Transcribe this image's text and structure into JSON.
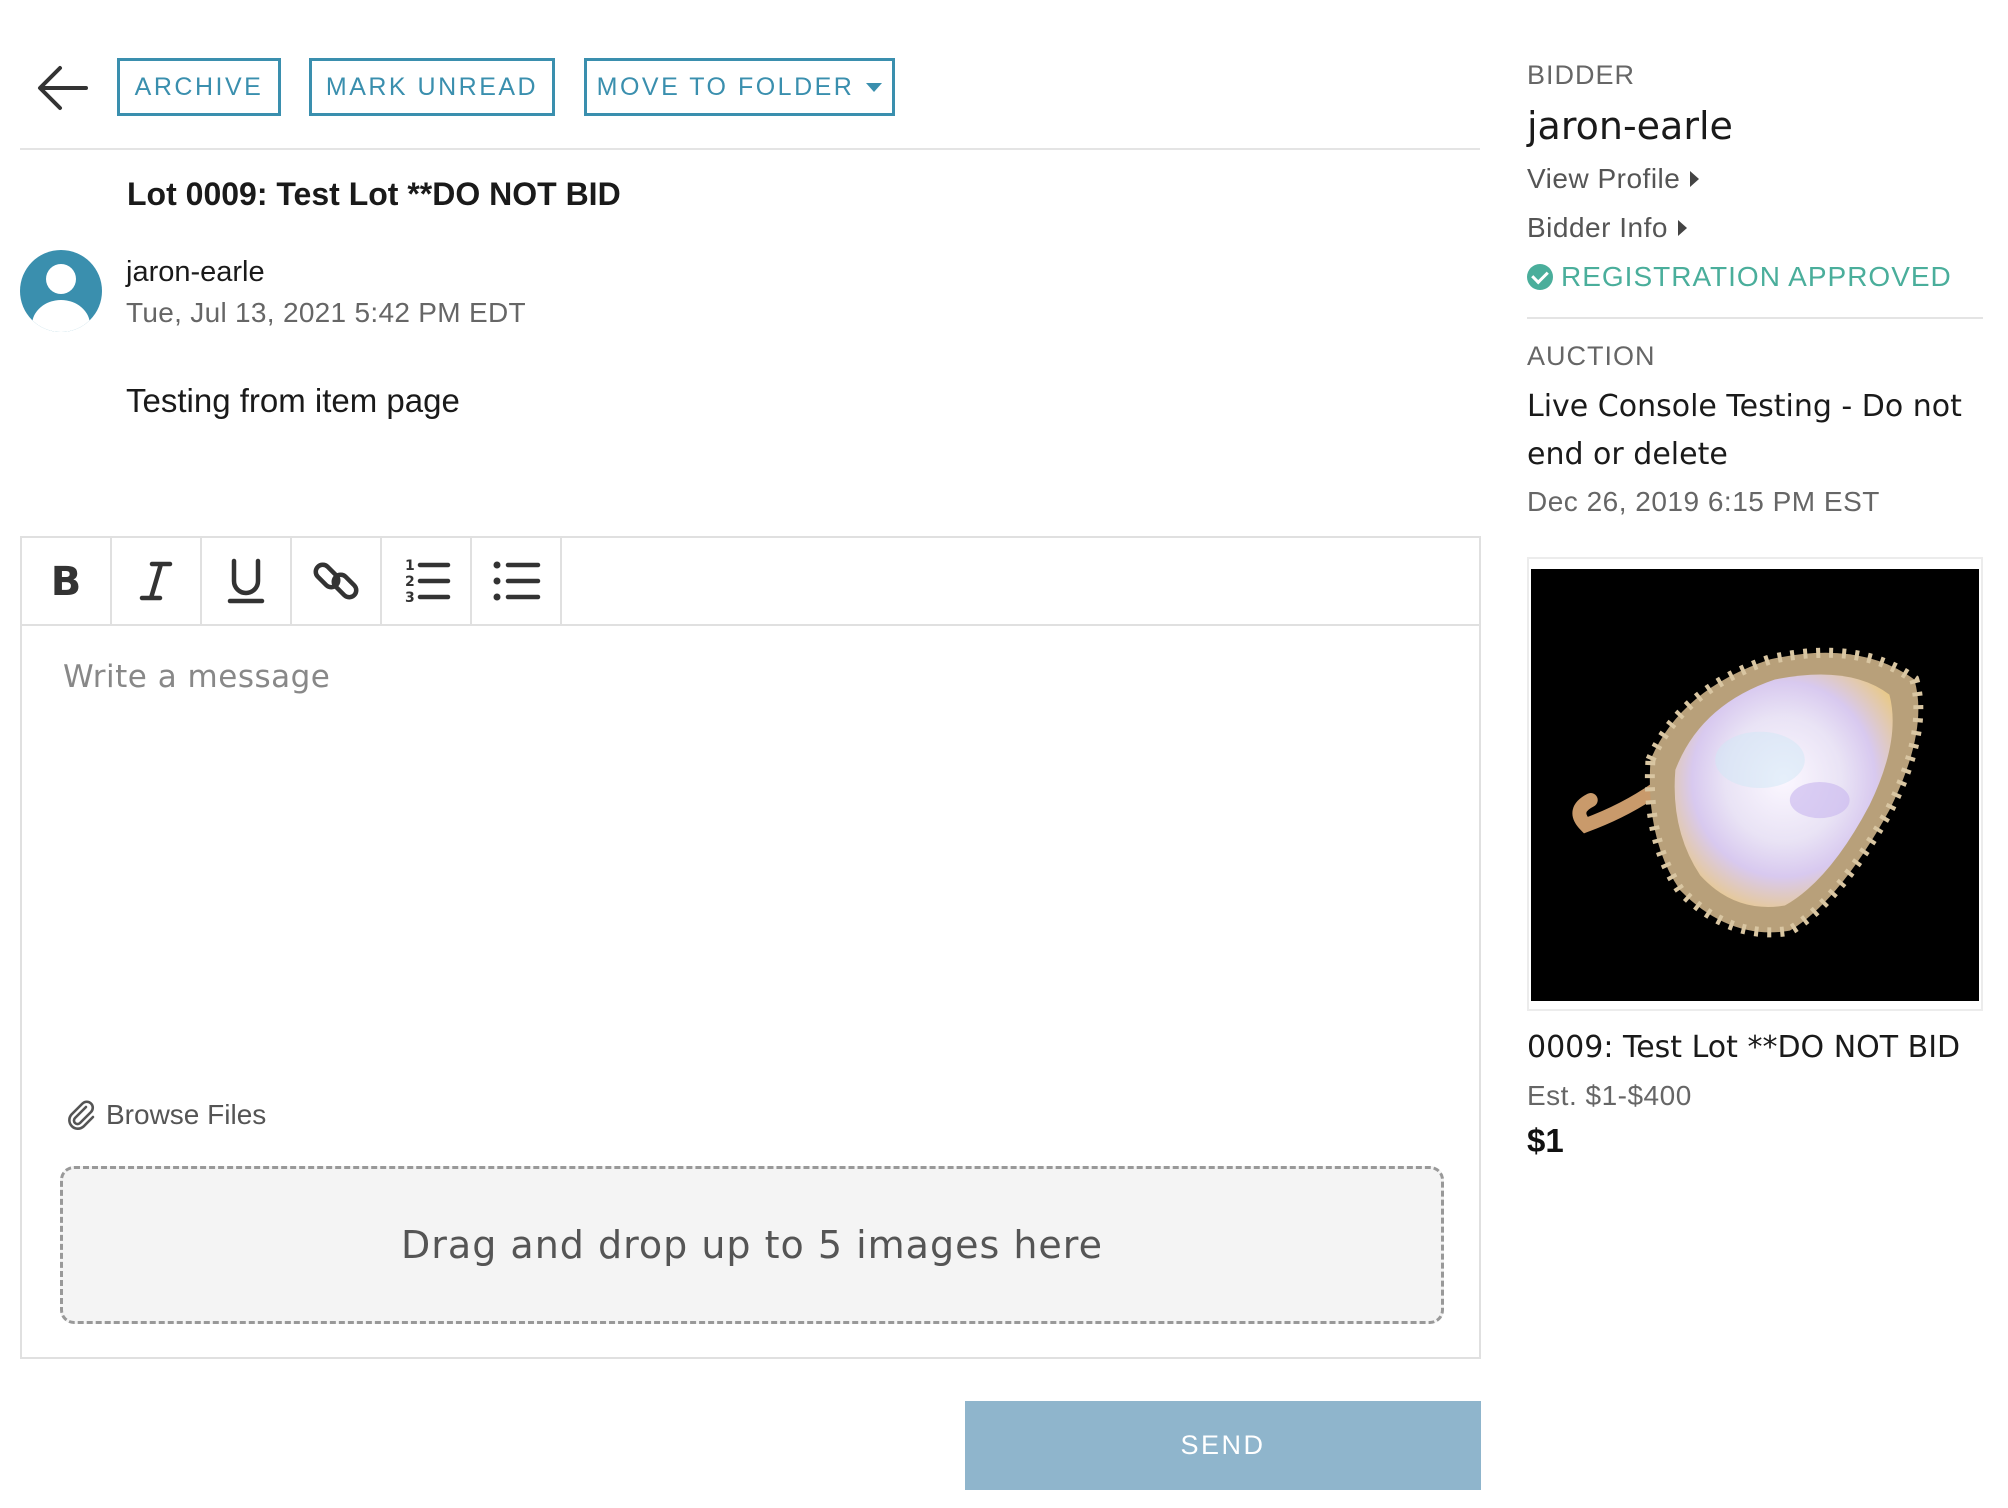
{
  "toolbar": {
    "archive_label": "ARCHIVE",
    "mark_unread_label": "MARK UNREAD",
    "move_to_folder_label": "MOVE TO FOLDER"
  },
  "message": {
    "subject": "Lot 0009: Test Lot **DO NOT BID",
    "sender": "jaron-earle",
    "date": "Tue, Jul 13, 2021 5:42 PM EDT",
    "body": "Testing from item page"
  },
  "editor": {
    "placeholder": "Write a message",
    "browse_files": "Browse Files",
    "dropzone": "Drag and drop up to 5 images here",
    "send_label": "SEND",
    "tools": [
      "bold-icon",
      "italic-icon",
      "underline-icon",
      "link-icon",
      "numbered-list-icon",
      "bulleted-list-icon"
    ]
  },
  "sidebar": {
    "bidder_label": "BIDDER",
    "bidder_name": "jaron-earle",
    "view_profile": "View Profile",
    "bidder_info": "Bidder Info",
    "registration_status": "REGISTRATION APPROVED",
    "auction_label": "AUCTION",
    "auction_name": "Live Console Testing - Do not end or delete",
    "auction_date": "Dec 26, 2019 6:15 PM EST",
    "lot_title": "0009: Test Lot **DO NOT BID",
    "estimate": "Est. $1-$400",
    "price": "$1"
  },
  "colors": {
    "accent": "#3a8fae",
    "approved": "#4aae9b",
    "send_button": "#8fb5cc"
  }
}
